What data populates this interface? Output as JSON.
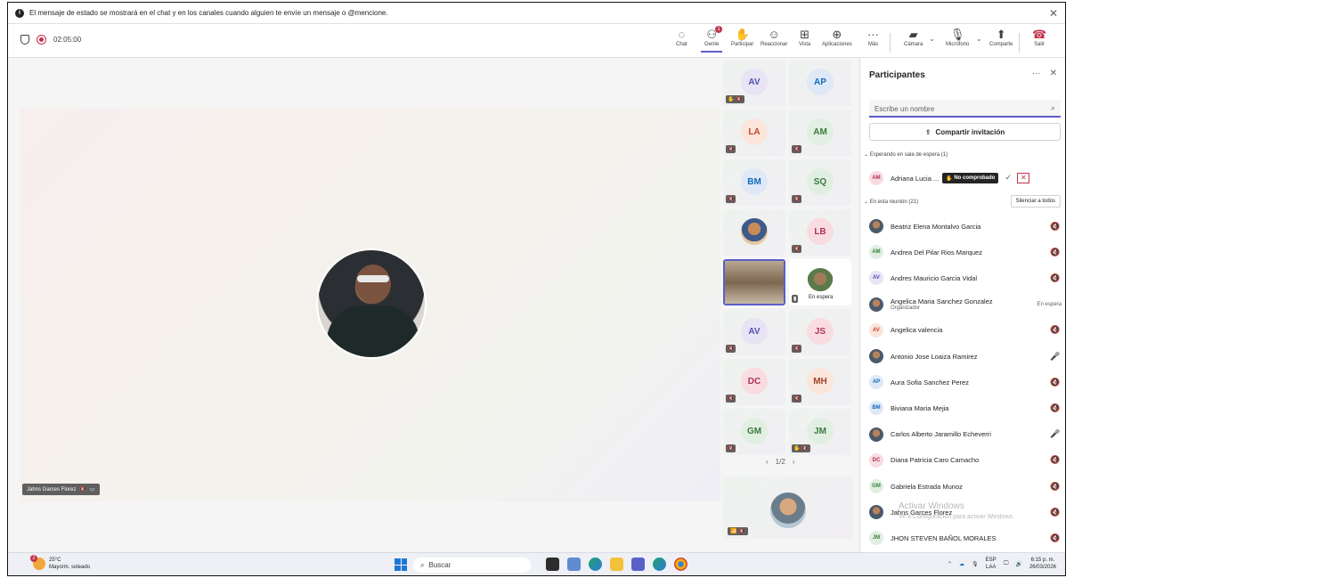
{
  "notification": {
    "text": "El mensaje de estado se mostrará en el chat y en los canales cuando alguien te envíe un mensaje o @mencione.",
    "close": "✕"
  },
  "meeting": {
    "timer": "02:05:00"
  },
  "toolbar": {
    "chat": "Chat",
    "people": "Gente",
    "people_badge": "1",
    "raise": "Participar",
    "react": "Reaccionar",
    "view": "Vista",
    "apps": "Aplicaciones",
    "more": "Más",
    "more_glyph": "···",
    "camera": "Cámara",
    "mic": "Micrófono",
    "share": "Comparte",
    "leave": "Salir"
  },
  "stage": {
    "speaker_name": "Jahns Garces Florez"
  },
  "tiles": [
    {
      "initials": "AV",
      "bg": "#e8e4f5",
      "fg": "#4f52b2"
    },
    {
      "initials": "AP",
      "bg": "#dfe8f6",
      "fg": "#0f6cbd"
    },
    {
      "initials": "LA",
      "bg": "#fbe6dc",
      "fg": "#c5432b"
    },
    {
      "initials": "AM",
      "bg": "#e1efe2",
      "fg": "#3b7a3d"
    },
    {
      "initials": "BM",
      "bg": "#dfe8f6",
      "fg": "#0f6cbd"
    },
    {
      "initials": "SQ",
      "bg": "#e1efe2",
      "fg": "#3b7a3d"
    },
    {
      "initials": "",
      "bg": "",
      "fg": ""
    },
    {
      "initials": "LB",
      "bg": "#f9dce2",
      "fg": "#b0325a"
    },
    {
      "initials": "",
      "bg": "",
      "fg": ""
    },
    {
      "initials": "",
      "bg": "",
      "fg": ""
    },
    {
      "initials": "AV",
      "bg": "#e8e4f5",
      "fg": "#4f52b2"
    },
    {
      "initials": "JS",
      "bg": "#f9dce2",
      "fg": "#b0325a"
    },
    {
      "initials": "DC",
      "bg": "#f9dce2",
      "fg": "#b0325a"
    },
    {
      "initials": "MH",
      "bg": "#fbe6dc",
      "fg": "#a1432b"
    },
    {
      "initials": "GM",
      "bg": "#e1efe2",
      "fg": "#3b7a3d"
    },
    {
      "initials": "JM",
      "bg": "#e1efe2",
      "fg": "#3b7a3d"
    }
  ],
  "waiting_tile_label": "En espera",
  "pager": {
    "prev": "‹",
    "label": "1/2",
    "next": "›"
  },
  "panel": {
    "title": "Participantes",
    "more": "···",
    "close": "✕",
    "search_placeholder": "Escribe un nombre",
    "share_invite": "Compartir invitación",
    "lobby_header": "Esperando en sala de espera (1)",
    "lobby_person": {
      "initials": "AM",
      "name": "Adriana Lucia ...",
      "status": "No comprobado"
    },
    "meeting_header": "En esta reunión (21)",
    "mute_all": "Silenciar a todos",
    "participants": [
      {
        "initials": "",
        "name": "Beatriz Elena Montalvo Garcia",
        "sub": "",
        "status": "🔇",
        "bg": "",
        "fg": ""
      },
      {
        "initials": "AM",
        "name": "Andrea Del Pilar Rios Marquez",
        "sub": "",
        "status": "🔇",
        "bg": "#e1efe2",
        "fg": "#3b7a3d"
      },
      {
        "initials": "AV",
        "name": "Andres Mauricio Garcia Vidal",
        "sub": "",
        "status": "🔇",
        "bg": "#e8e4f5",
        "fg": "#4f52b2"
      },
      {
        "initials": "",
        "name": "Angelica Maria Sanchez Gonzalez",
        "sub": "Organizador",
        "status": "En espera",
        "bg": "",
        "fg": ""
      },
      {
        "initials": "AV",
        "name": "Angelica valencia",
        "sub": "",
        "status": "🔇",
        "bg": "#fbe6dc",
        "fg": "#c5432b"
      },
      {
        "initials": "",
        "name": "Antonio Jose Loaiza Ramirez",
        "sub": "",
        "status": "🎤",
        "bg": "",
        "fg": ""
      },
      {
        "initials": "AP",
        "name": "Aura Sofia Sanchez Perez",
        "sub": "",
        "status": "🔇",
        "bg": "#dfe8f6",
        "fg": "#0f6cbd"
      },
      {
        "initials": "BM",
        "name": "Biviana Maria Mejia",
        "sub": "",
        "status": "🔇",
        "bg": "#dfe8f6",
        "fg": "#0f6cbd"
      },
      {
        "initials": "",
        "name": "Carlos Alberto Jaramillo Echeverri",
        "sub": "",
        "status": "🎤",
        "bg": "",
        "fg": ""
      },
      {
        "initials": "DC",
        "name": "Diana Patricia Caro Camacho",
        "sub": "",
        "status": "🔇",
        "bg": "#f9dce2",
        "fg": "#b0325a"
      },
      {
        "initials": "GM",
        "name": "Gabriela Estrada Munoz",
        "sub": "",
        "status": "🔇",
        "bg": "#e1efe2",
        "fg": "#3b7a3d"
      },
      {
        "initials": "",
        "name": "Jahns Garces Florez",
        "sub": "",
        "status": "🔇",
        "bg": "",
        "fg": ""
      },
      {
        "initials": "JM",
        "name": "JHON STEVEN BAÑOL MORALES",
        "sub": "",
        "status": "🔇",
        "bg": "#e1efe2",
        "fg": "#3b7a3d"
      }
    ]
  },
  "watermark": {
    "line1": "Activar Windows",
    "line2": "Ve a Configuración para activar Windows."
  },
  "taskbar": {
    "temp": "25°C",
    "weather": "Mayorm. soleado",
    "weather_badge": "2",
    "search": "Buscar",
    "lang": "ESP",
    "layout": "LAA",
    "time": "6:15 p. m.",
    "date": "26/03/2026"
  }
}
